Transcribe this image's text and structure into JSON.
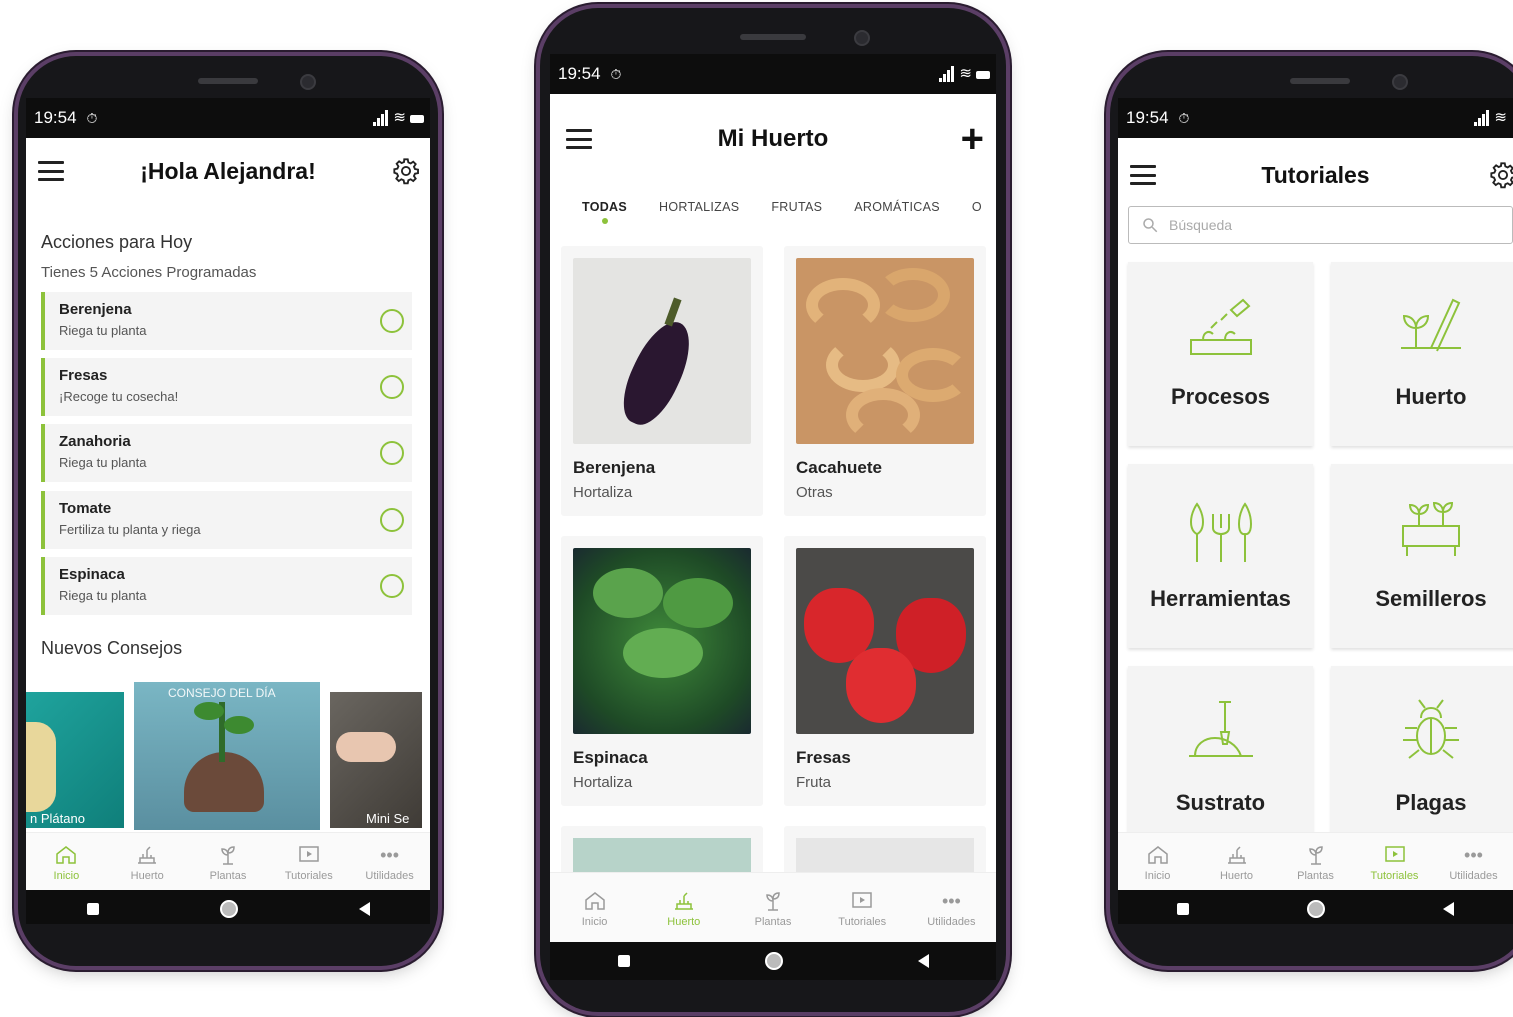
{
  "status": {
    "time": "19:54"
  },
  "nav": {
    "inicio": "Inicio",
    "huerto": "Huerto",
    "plantas": "Plantas",
    "tutoriales": "Tutoriales",
    "utilidades": "Utilidades"
  },
  "home": {
    "greeting": "¡Hola Alejandra!",
    "today_title": "Acciones para Hoy",
    "today_subtitle": "Tienes 5 Acciones Programadas",
    "actions": [
      {
        "name": "Berenjena",
        "desc": "Riega tu planta"
      },
      {
        "name": "Fresas",
        "desc": "¡Recoge tu cosecha!"
      },
      {
        "name": "Zanahoria",
        "desc": "Riega tu planta"
      },
      {
        "name": "Tomate",
        "desc": "Fertiliza tu planta y riega"
      },
      {
        "name": "Espinaca",
        "desc": "Riega tu planta"
      }
    ],
    "tips_title": "Nuevos Consejos",
    "tips": [
      {
        "caption": "n Plátano"
      },
      {
        "caption": "CONSEJO DEL DÍA"
      },
      {
        "caption": "Mini Se"
      }
    ]
  },
  "garden": {
    "title": "Mi Huerto",
    "tabs": [
      "TODAS",
      "HORTALIZAS",
      "FRUTAS",
      "AROMÁTICAS",
      "O"
    ],
    "cards": [
      {
        "name": "Berenjena",
        "category": "Hortaliza"
      },
      {
        "name": "Cacahuete",
        "category": "Otras"
      },
      {
        "name": "Espinaca",
        "category": "Hortaliza"
      },
      {
        "name": "Fresas",
        "category": "Fruta"
      }
    ]
  },
  "tutorials": {
    "title": "Tutoriales",
    "search_placeholder": "Búsqueda",
    "tiles": [
      "Procesos",
      "Huerto",
      "Herramientas",
      "Semilleros",
      "Sustrato",
      "Plagas"
    ]
  },
  "colors": {
    "accent": "#8dc23b",
    "frame": "#5b3e66"
  }
}
